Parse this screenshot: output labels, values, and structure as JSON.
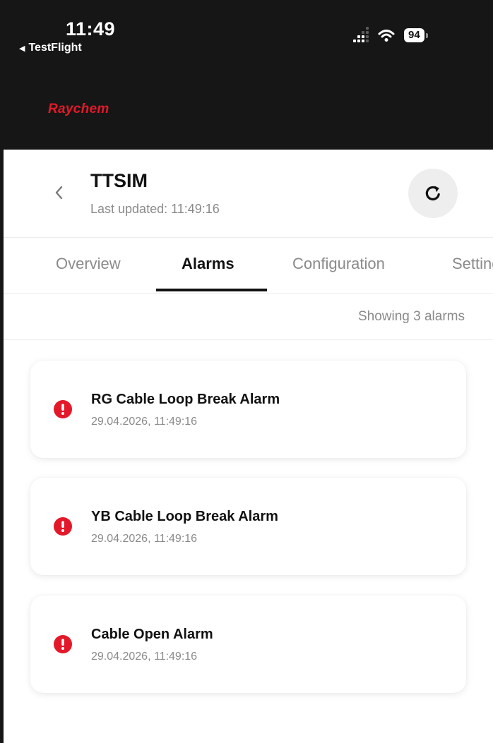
{
  "status_bar": {
    "time": "11:49",
    "back_app": "TestFlight",
    "back_icon": "triangle-left-icon",
    "battery": "94"
  },
  "header": {
    "brand": "Raychem",
    "brand_color": "#e3192a",
    "background": "#161616"
  },
  "device": {
    "name": "TTSIM",
    "last_updated": "Last updated: 11:49:16",
    "back_icon": "chevron-left-icon",
    "refresh_icon": "refresh-icon"
  },
  "tabs": [
    {
      "label": "Overview",
      "active": false
    },
    {
      "label": "Alarms",
      "active": true
    },
    {
      "label": "Configuration",
      "active": false
    },
    {
      "label": "Settings",
      "active": false
    }
  ],
  "alarms_count": "Showing 3 alarms",
  "alarms": [
    {
      "title": "RG Cable Loop Break Alarm",
      "timestamp": "29.04.2026, 11:49:16",
      "icon": "alert-circle-icon"
    },
    {
      "title": "YB Cable Loop Break Alarm",
      "timestamp": "29.04.2026, 11:49:16",
      "icon": "alert-circle-icon"
    },
    {
      "title": "Cable Open Alarm",
      "timestamp": "29.04.2026, 11:49:16",
      "icon": "alert-circle-icon"
    }
  ],
  "colors": {
    "alarm_red": "#e3192a",
    "text_primary": "#111111",
    "text_secondary": "#8a8a8a"
  }
}
